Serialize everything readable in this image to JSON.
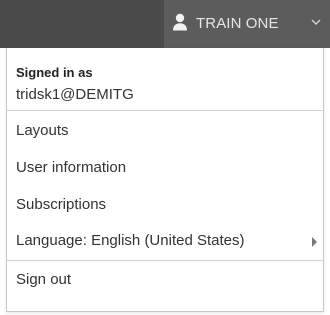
{
  "header": {
    "user_name": "TRAIN ONE",
    "user_icon": "user-icon",
    "dropdown_icon": "chevron-down-icon"
  },
  "menu": {
    "signed_in_label": "Signed in as",
    "user_id": "tridsk1@DEMITG",
    "items": [
      {
        "label": "Layouts"
      },
      {
        "label": "User information"
      },
      {
        "label": "Subscriptions"
      },
      {
        "label": "Language: English (United States)",
        "submenu_icon": "arrow-right-icon"
      }
    ],
    "sign_out_label": "Sign out"
  },
  "colors": {
    "topbar": "#4b4b4b",
    "user_button": "#5c5c5c",
    "text": "#333333",
    "divider": "#d2d2d2"
  }
}
